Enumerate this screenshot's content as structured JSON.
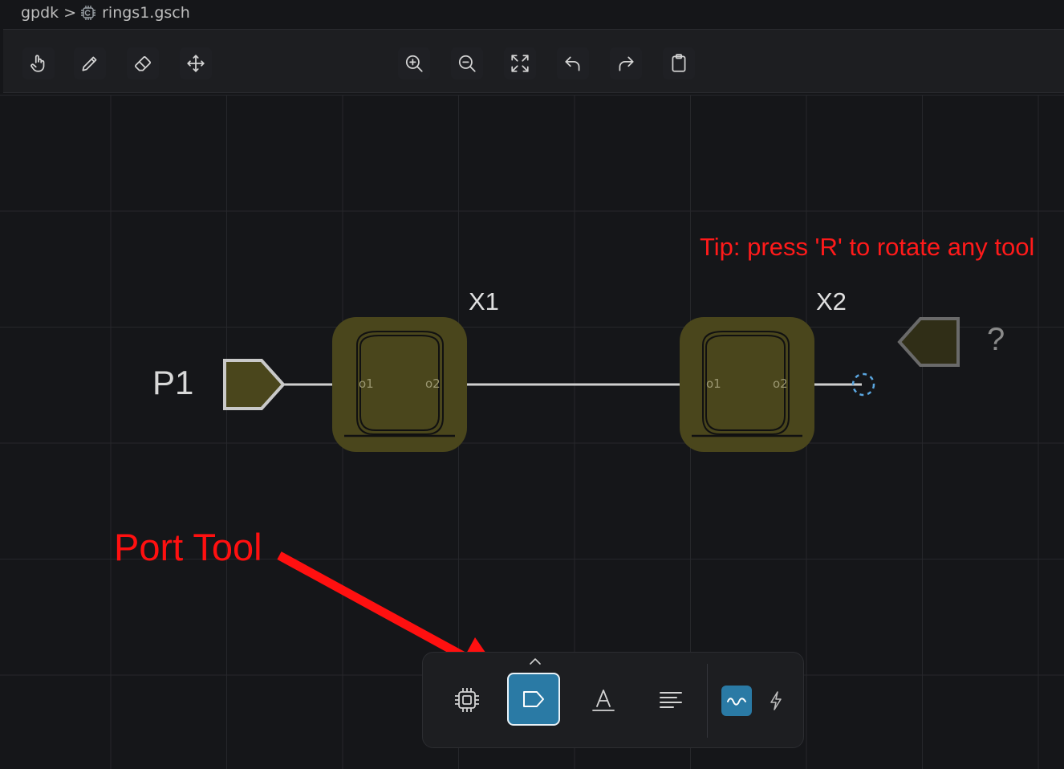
{
  "breadcrumb": {
    "root": "gpdk",
    "separator": ">",
    "file": "rings1.gsch",
    "file_icon": "chip-file-icon"
  },
  "toolbar": {
    "left_tools": [
      {
        "name": "hand-tool",
        "icon": "hand-pointer-icon"
      },
      {
        "name": "pencil-tool",
        "icon": "pencil-icon"
      },
      {
        "name": "eraser-tool",
        "icon": "eraser-icon"
      },
      {
        "name": "move-tool",
        "icon": "move-arrows-icon"
      }
    ],
    "center_tools": [
      {
        "name": "zoom-in",
        "icon": "zoom-in-icon"
      },
      {
        "name": "zoom-out",
        "icon": "zoom-out-icon"
      },
      {
        "name": "fit-view",
        "icon": "fit-view-icon"
      },
      {
        "name": "undo",
        "icon": "undo-icon"
      },
      {
        "name": "redo",
        "icon": "redo-icon"
      },
      {
        "name": "clipboard",
        "icon": "clipboard-icon"
      }
    ]
  },
  "schematic": {
    "port_p1_label": "P1",
    "instance_x1_label": "X1",
    "instance_x2_label": "X2",
    "pin_o1": "o1",
    "pin_o2": "o2",
    "ghost_port_label": "?",
    "instance_color": "#4a461c",
    "wire_color": "#cfcfcf"
  },
  "annotations": {
    "tip": "Tip: press 'R' to rotate any tool",
    "port_tool": "Port Tool",
    "annotation_color": "#ff1a1a"
  },
  "dock": {
    "tools": [
      {
        "name": "component-tool",
        "icon": "chip-icon"
      },
      {
        "name": "port-tool",
        "icon": "port-icon",
        "active": true
      },
      {
        "name": "text-tool",
        "icon": "text-a-icon"
      },
      {
        "name": "align-tool",
        "icon": "align-lines-icon"
      }
    ],
    "mode_toggles": [
      {
        "name": "optical-mode",
        "icon": "wave-icon",
        "active": true
      },
      {
        "name": "electrical-mode",
        "icon": "lightning-icon",
        "active": false
      }
    ],
    "accent": "#2a7aa5"
  }
}
